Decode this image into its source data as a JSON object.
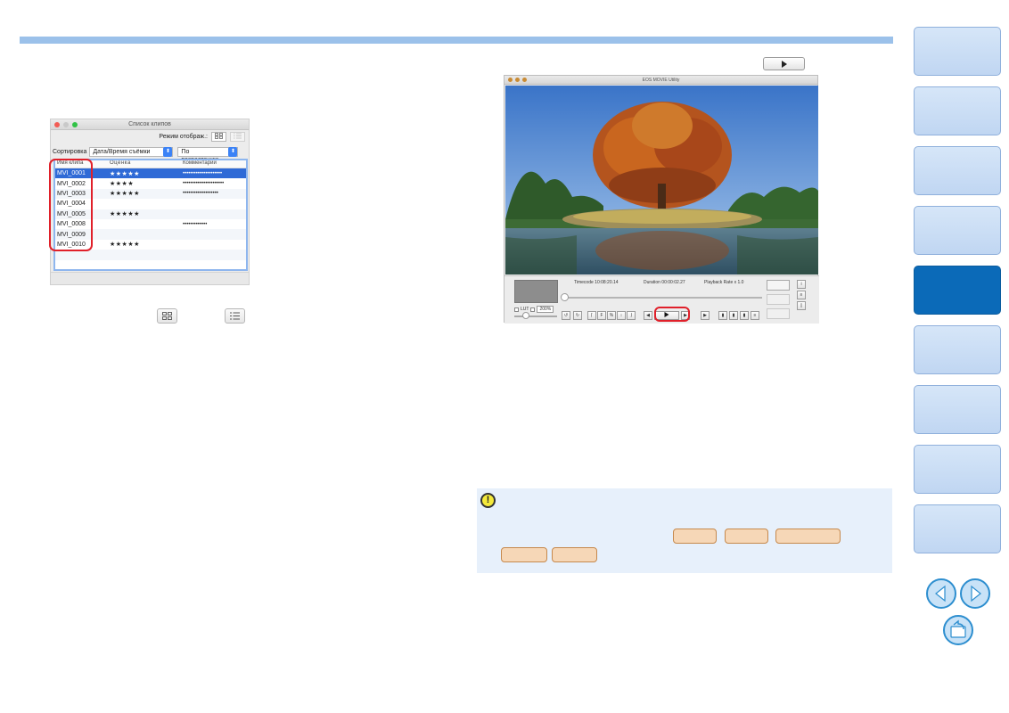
{
  "clip_list_window": {
    "title": "Список клипов",
    "view_mode_label": "Режим отображ.:",
    "sort_label": "Сортировка",
    "sort_field": "Дата/Время съёмки",
    "sort_order": "По возрастанию",
    "columns": [
      "Имя клипа",
      "Оценка",
      "Комментарий"
    ],
    "rows": [
      {
        "name": "MVI_0001",
        "rating": "★★★★★",
        "comment": "•••••••••••••••••••••",
        "selected": true
      },
      {
        "name": "MVI_0002",
        "rating": "★★★★",
        "comment": "••••••••••••••••••••••",
        "selected": false
      },
      {
        "name": "MVI_0003",
        "rating": "★★★★★",
        "comment": "•••••••••••••••••••",
        "selected": false
      },
      {
        "name": "MVI_0004",
        "rating": "",
        "comment": "",
        "selected": false
      },
      {
        "name": "MVI_0005",
        "rating": "★★★★★",
        "comment": "",
        "selected": false
      },
      {
        "name": "MVI_0008",
        "rating": "",
        "comment": "•••••••••••••",
        "selected": false
      },
      {
        "name": "MVI_0009",
        "rating": "",
        "comment": "",
        "selected": false
      },
      {
        "name": "MVI_0010",
        "rating": "★★★★★",
        "comment": "",
        "selected": false
      }
    ]
  },
  "eos_window": {
    "title": "EOS MOVIE Utility",
    "timecode": "Timecode 10:08:20.14",
    "duration": "Duration 00:00:02.27",
    "playback_rate": "Playback Rate x 1.0",
    "lut_label": "LUT",
    "zoom_value": "200%"
  },
  "icons": {
    "play": "play-icon",
    "thumbnail_view": "thumbnail-view-icon",
    "list_view": "list-view-icon",
    "caution": "caution-icon",
    "prev_page": "arrow-left-icon",
    "next_page": "arrow-right-icon",
    "return": "return-icon"
  },
  "colors": {
    "accent_bar": "#9bc1ea",
    "highlight": "#e0202a",
    "nav_active": "#0b6ab8",
    "nav_tab": "#c8dcf4",
    "caution_bg": "#e7f0fb",
    "reference_tag": "#f6d7b7"
  }
}
